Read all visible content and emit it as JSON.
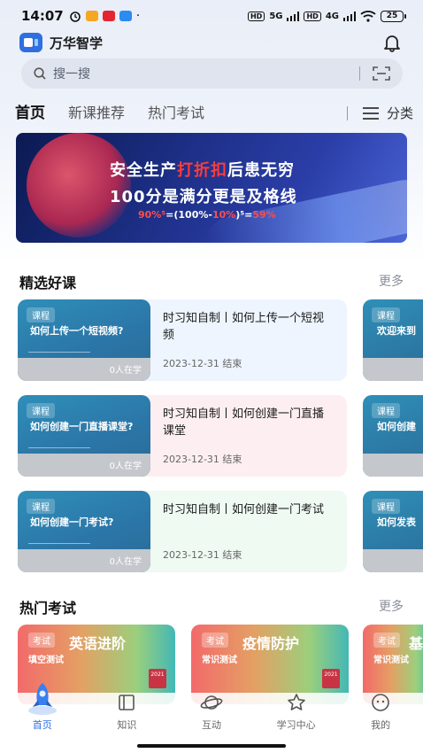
{
  "status": {
    "time": "14:07",
    "net1": "5G",
    "net2": "4G",
    "battery": "25"
  },
  "app": {
    "name": "万华智学"
  },
  "search": {
    "placeholder": "搜一搜"
  },
  "tabs": [
    {
      "label": "首页",
      "active": true
    },
    {
      "label": "新课推荐",
      "active": false
    },
    {
      "label": "热门考试",
      "active": false
    }
  ],
  "category_label": "分类",
  "banner": {
    "line1_a": "安全生产",
    "line1_hl": "打折扣",
    "line1_b": "后患无穷",
    "line2": "100分是满分更是及格线",
    "line3_a": "90%⁵",
    "line3_b": "=(100%-",
    "line3_c": "10%",
    "line3_d": ")⁵=",
    "line3_e": "59%"
  },
  "featured": {
    "title": "精选好课",
    "more": "更多",
    "courses": [
      {
        "tag": "课程",
        "thumb_title": "如何上传一个短视频?",
        "learners": "0人在学",
        "title": "时习知自制丨如何上传一个短视频",
        "date": "2023-12-31 结束",
        "peek_tag": "课程",
        "peek_title": "欢迎来到"
      },
      {
        "tag": "课程",
        "thumb_title": "如何创建一门直播课堂?",
        "learners": "0人在学",
        "title": "时习知自制丨如何创建一门直播课堂",
        "date": "2023-12-31 结束",
        "peek_tag": "课程",
        "peek_title": "如何创建"
      },
      {
        "tag": "课程",
        "thumb_title": "如何创建一门考试?",
        "learners": "0人在学",
        "title": "时习知自制丨如何创建一门考试",
        "date": "2023-12-31 结束",
        "peek_tag": "课程",
        "peek_title": "如何发表"
      }
    ]
  },
  "exams": {
    "title": "热门考试",
    "more": "更多",
    "items": [
      {
        "tag": "考试",
        "title": "英语进阶",
        "subtitle": "填空测试",
        "cal": "2021"
      },
      {
        "tag": "考试",
        "title": "疫情防护",
        "subtitle": "常识测试",
        "cal": "2021"
      },
      {
        "tag": "考试",
        "title": "基",
        "subtitle": "常识测试",
        "cal": ""
      }
    ]
  },
  "nav": [
    {
      "label": "首页",
      "icon": "rocket-icon",
      "active": true
    },
    {
      "label": "知识",
      "icon": "book-icon",
      "active": false
    },
    {
      "label": "互动",
      "icon": "planet-icon",
      "active": false
    },
    {
      "label": "学习中心",
      "icon": "star-icon",
      "active": false
    },
    {
      "label": "我的",
      "icon": "face-icon",
      "active": false
    }
  ],
  "colors": {
    "accent": "#2f6fe0",
    "banner_highlight": "#ff3b3b"
  }
}
